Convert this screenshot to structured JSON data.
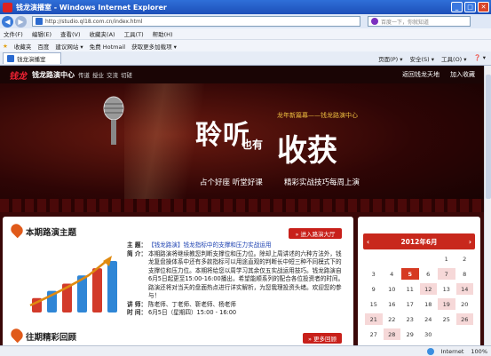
{
  "window": {
    "title": "钱龙演播室 - Windows Internet Explorer",
    "address": "http://studio.ql18.com.cn/index.html",
    "search_placeholder": "百度一下，你就知道"
  },
  "menu": [
    "文件(F)",
    "编辑(E)",
    "查看(V)",
    "收藏夹(A)",
    "工具(T)",
    "帮助(H)"
  ],
  "favbar": {
    "favorites": "收藏夹",
    "items": [
      "百度",
      "建议网站 ▾",
      "免费 Hotmail",
      "获取更多加载项 ▾"
    ]
  },
  "tab": {
    "label": "钱龙演播室",
    "tools": [
      "页面(P) ▾",
      "安全(S) ▾",
      "工具(O) ▾",
      "❓ ▾"
    ]
  },
  "site": {
    "logo": "钱龙",
    "brand": "钱龙路演中心",
    "nav": [
      "传道",
      "授业",
      "交流",
      "切磋"
    ],
    "links": [
      "返回钱龙天地",
      "加入收藏"
    ]
  },
  "banner": {
    "subtitle": "龙年新篇幕——钱龙路演中心",
    "big_left": "聆听",
    "big_mid": "也有",
    "big_right": "收获",
    "slogan_left": "占个好座  听堂好课",
    "slogan_right": "精彩实战技巧每周上演"
  },
  "panel": {
    "title": "本期路演主题",
    "enter_btn": "» 进入路演大厅",
    "topic_label": "主  题：",
    "topic": "【钱龙路演】钱龙指标中的支撑和压力实战运用",
    "intro_label": "简  介：",
    "intro": "本期路演将继续教您判断支撑位和压力位。除却上周讲述的六种方法外，钱龙复盘操体系中还有多款指标可以用途直观的判断长中短三种不同模式下的支撑位和压力位。本期将给您以周学习其余仅五实战运用技巧。钱龙路演自6月5日起更至15:00-16:00播出，希望能顺系列的配合各位投资者的时间。路演还将对当天的盘面热点进行详实解析，为您我理投资头绪。欢迎您的参与！",
    "teacher_label": "讲  师：",
    "teachers": "陈老师、丁老师、靳老师、杨老师",
    "time_label": "时  间：",
    "time": "6月5日（星期四）15:00 - 16:00",
    "past_title": "往期精彩回顾",
    "more_btn": "» 更多回顾",
    "bars": [
      0.28,
      0.42,
      0.56,
      0.72,
      0.86,
      1.0
    ]
  },
  "calendar": {
    "month": "2012年6月",
    "prev": "‹",
    "next": "›",
    "days": [
      "",
      "",
      "",
      "",
      "1",
      "2",
      "3",
      "4",
      "5",
      "6",
      "7",
      "8",
      "9",
      "10",
      "11",
      "12",
      "13",
      "14",
      "15",
      "16",
      "17",
      "18",
      "19",
      "20",
      "21",
      "22",
      "23",
      "24",
      "25",
      "26",
      "27",
      "28",
      "29",
      "30"
    ],
    "today": "5",
    "active": [
      "7",
      "12",
      "14",
      "19",
      "21",
      "26",
      "28"
    ]
  },
  "status": {
    "zone": "Internet",
    "zoom": "100%"
  }
}
